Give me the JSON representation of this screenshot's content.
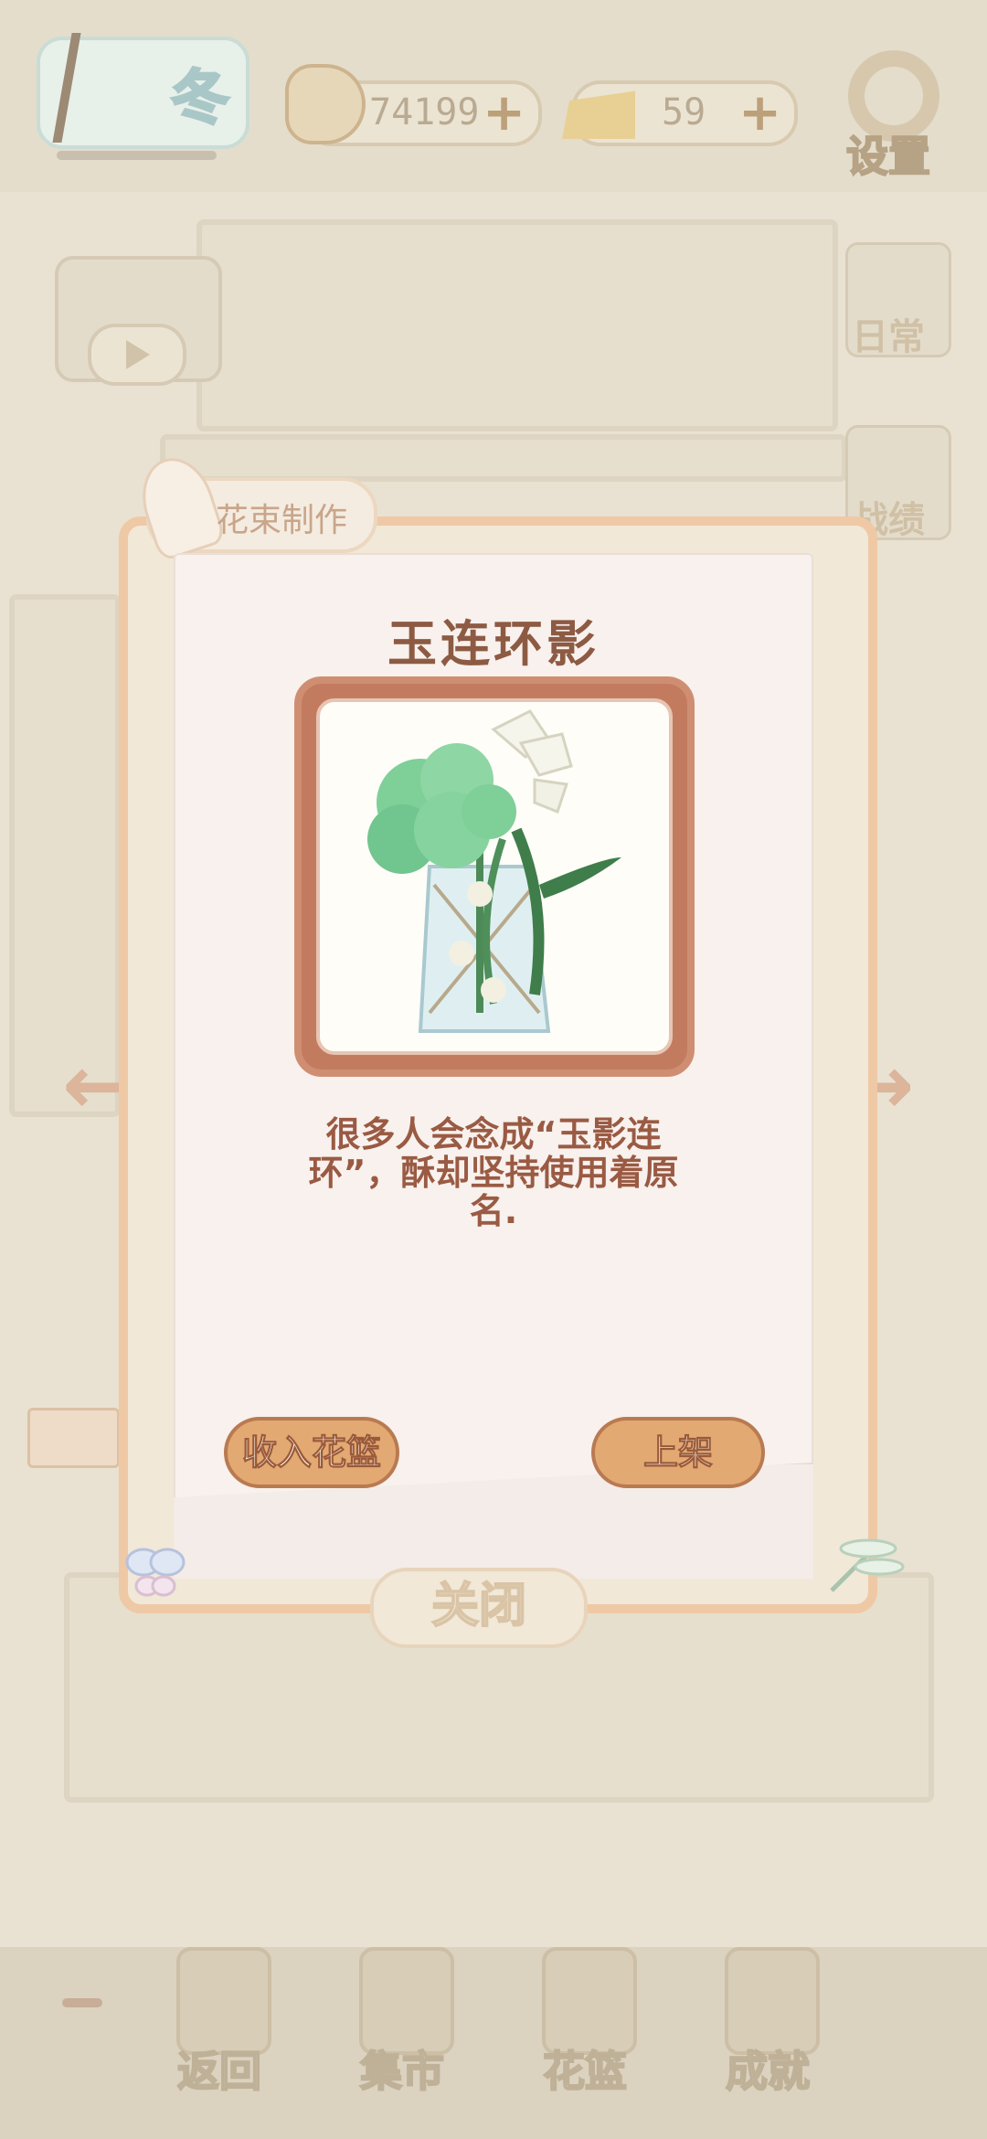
{
  "hud": {
    "season": "冬",
    "fish_currency": "74199",
    "cheese_currency": "59",
    "plus_symbol": "+",
    "settings_label": "设置"
  },
  "side_menu": {
    "daily_label": "日常",
    "rank_label": "战绩"
  },
  "dialog": {
    "tab_label": "花束制作",
    "bouquet_name": "玉连环影",
    "description": "很多人会念成“玉影连环”，酥却坚持使用着原名.",
    "basket_button": "收入花篮",
    "shelve_button": "上架",
    "close_button": "关闭"
  },
  "bottom_nav": {
    "items": [
      {
        "label": "返回",
        "icon": "back-door-icon"
      },
      {
        "label": "集市",
        "icon": "market-stall-icon"
      },
      {
        "label": "花篮",
        "icon": "flower-basket-icon"
      },
      {
        "label": "成就",
        "icon": "trophy-icon"
      }
    ]
  },
  "colors": {
    "title": "#8d5a43",
    "button_fill": "#e3a972",
    "frame": "#c37b60"
  }
}
